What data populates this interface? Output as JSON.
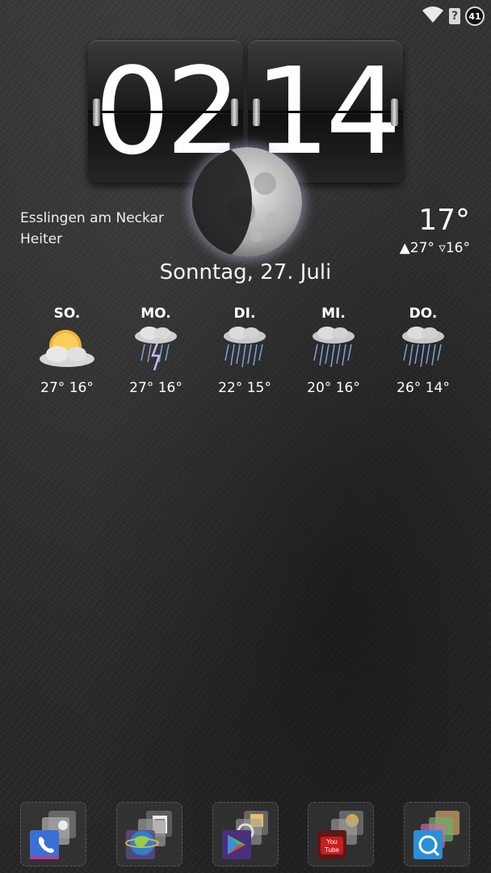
{
  "status_bar": {
    "wifi_icon": "wifi-icon",
    "signal_unknown_icon": "?",
    "notification_count": "41"
  },
  "clock": {
    "hours": "02",
    "minutes": "14"
  },
  "weather": {
    "location": "Esslingen am Neckar",
    "condition": "Heiter",
    "current_temp": "17°",
    "high": "▲27°",
    "low": "▿16°",
    "moon_icon": "moon-icon"
  },
  "date": "Sonntag, 27. Juli",
  "forecast": [
    {
      "day": "SO.",
      "temps": "27° 16°",
      "icon": "sun-cloud-icon"
    },
    {
      "day": "MO.",
      "temps": "27° 16°",
      "icon": "thunderstorm-icon"
    },
    {
      "day": "DI.",
      "temps": "22° 15°",
      "icon": "rain-icon"
    },
    {
      "day": "MI.",
      "temps": "20° 16°",
      "icon": "rain-icon"
    },
    {
      "day": "DO.",
      "temps": "26° 14°",
      "icon": "rain-icon"
    }
  ],
  "dock": [
    {
      "name": "phone-folder",
      "icon": "phone-icon"
    },
    {
      "name": "browser-folder",
      "icon": "globe-icon"
    },
    {
      "name": "play-store-folder",
      "icon": "play-store-icon"
    },
    {
      "name": "youtube-folder",
      "icon": "youtube-icon",
      "label": "You Tube"
    },
    {
      "name": "camera-folder",
      "icon": "camera-icon"
    }
  ],
  "colors": {
    "accent_phone": "#3b6fd6",
    "accent_youtube": "#c81e1e",
    "rain": "#7fa3d8",
    "lightning": "#b9a8ff"
  }
}
